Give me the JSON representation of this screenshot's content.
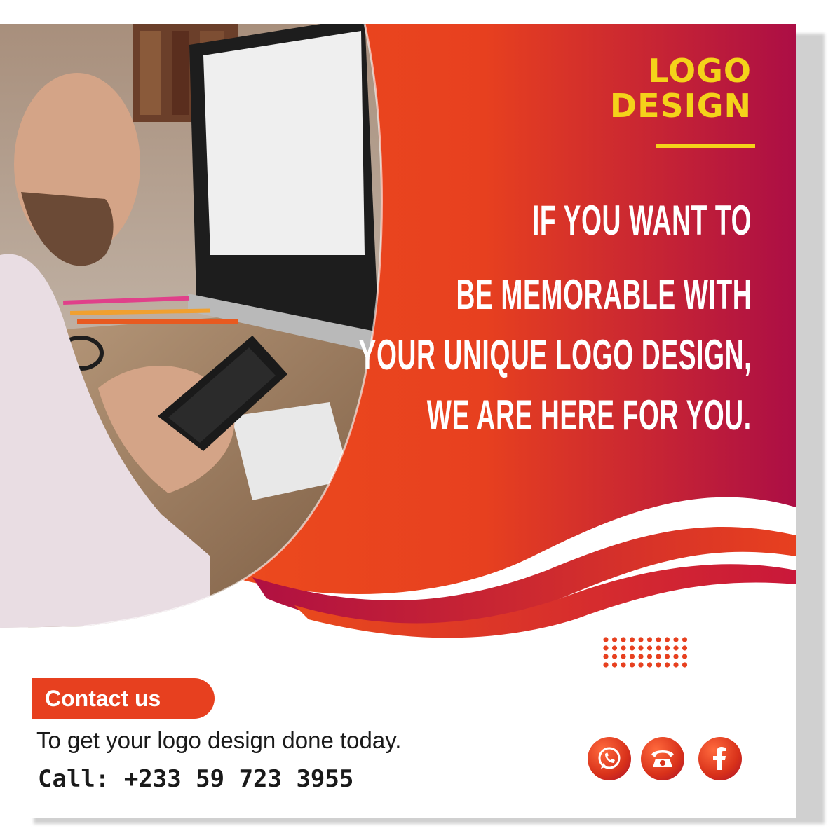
{
  "flyer": {
    "service_title_line1": "LOGO",
    "service_title_line2": "DESIGN",
    "headline": [
      "IF YOU WANT TO",
      "BE MEMORABLE WITH",
      "YOUR UNIQUE LOGO DESIGN,",
      "WE ARE HERE FOR YOU."
    ],
    "contact_label": "Contact us",
    "contact_text": "To get your logo design done today.",
    "phone_line": "Call: +233 59 723 3955"
  },
  "icons": {
    "social": [
      "whatsapp-icon",
      "telephone-icon",
      "facebook-icon"
    ]
  },
  "colors": {
    "orange": "#e7401f",
    "crimson": "#b01042",
    "accent_yellow": "#f4d31a"
  }
}
